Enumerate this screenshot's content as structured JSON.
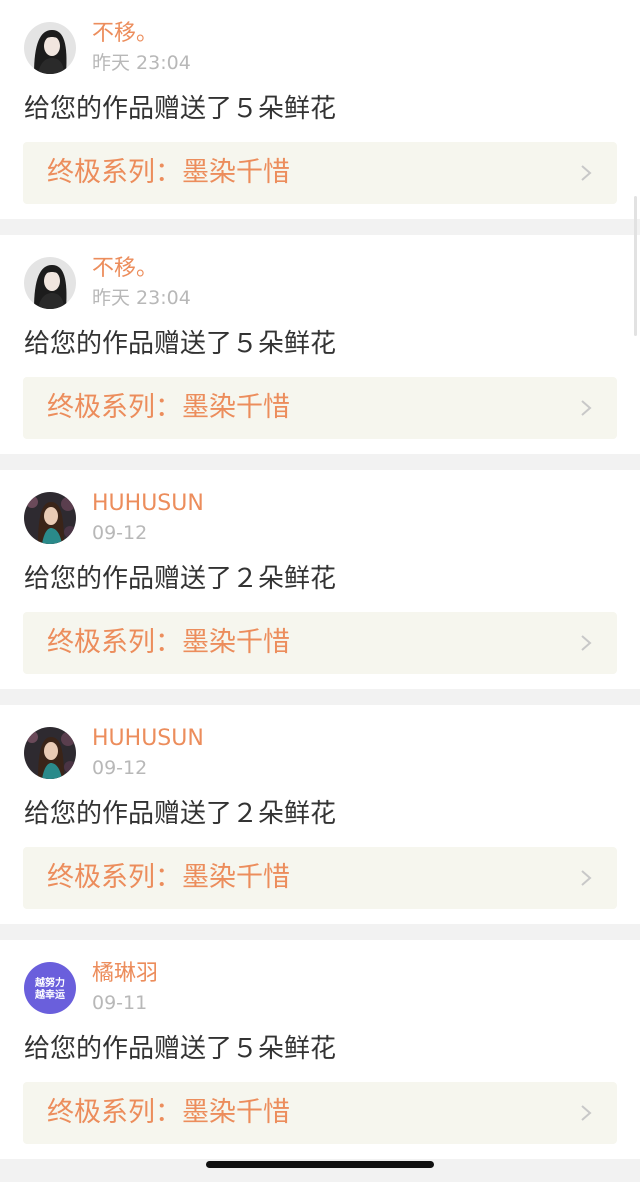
{
  "colors": {
    "accent": "#ec8d5c",
    "time": "#b8b8b8",
    "message": "#333333",
    "link_bg": "#f6f6ee",
    "page_bg": "#f2f2f2"
  },
  "notifications": [
    {
      "username": "不移。",
      "time": "昨天 23:04",
      "message": "给您的作品赠送了５朵鲜花",
      "work_title": "终极系列：墨染千惜",
      "avatar": "dark-haired-woman"
    },
    {
      "username": "不移。",
      "time": "昨天 23:04",
      "message": "给您的作品赠送了５朵鲜花",
      "work_title": "终极系列：墨染千惜",
      "avatar": "dark-haired-woman"
    },
    {
      "username": "HUHUSUN",
      "time": "09-12",
      "message": "给您的作品赠送了２朵鲜花",
      "work_title": "终极系列：墨染千惜",
      "avatar": "woman-portrait"
    },
    {
      "username": "HUHUSUN",
      "time": "09-12",
      "message": "给您的作品赠送了２朵鲜花",
      "work_title": "终极系列：墨染千惜",
      "avatar": "woman-portrait"
    },
    {
      "username": "橘琳羽",
      "time": "09-11",
      "message": "给您的作品赠送了５朵鲜花",
      "work_title": "终极系列：墨染千惜",
      "avatar": "purple-text-badge",
      "avatar_text": "越努力越幸运"
    }
  ]
}
